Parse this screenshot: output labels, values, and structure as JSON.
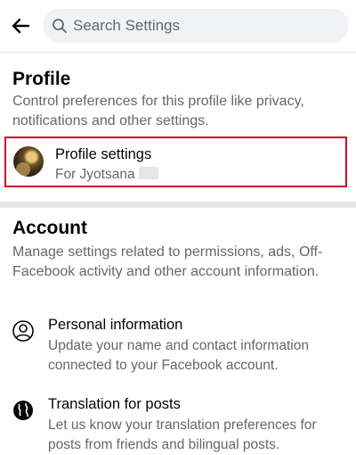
{
  "header": {
    "back_icon": "arrow-left-icon",
    "search_placeholder": "Search Settings",
    "search_icon": "search-icon"
  },
  "profile": {
    "title": "Profile",
    "description": "Control preferences for this profile like privacy, notifications and other settings.",
    "settings_item": {
      "label": "Profile settings",
      "sublabel": "For Jyotsana",
      "highlight_color": "#c8102e"
    }
  },
  "account": {
    "title": "Account",
    "description": "Manage settings related to permissions, ads, Off-Facebook activity and other account information.",
    "items": [
      {
        "icon": "person-circle-icon",
        "label": "Personal information",
        "description": "Update your name and contact information connected to your Facebook account."
      },
      {
        "icon": "globe-icon",
        "label": "Translation for posts",
        "description": "Let us know your translation preferences for posts from friends and bilingual posts."
      }
    ]
  }
}
